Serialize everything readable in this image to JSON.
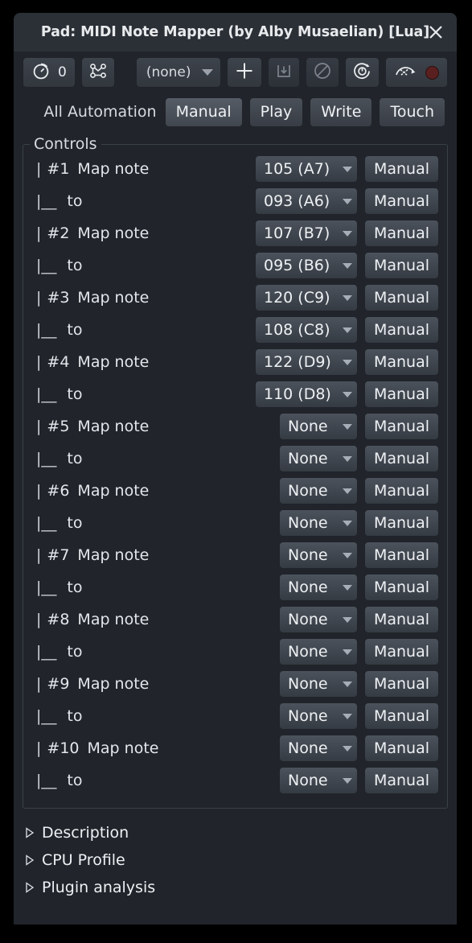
{
  "window": {
    "title": "Pad: MIDI Note Mapper (by Alby Musaelian) [Lua]",
    "close_icon": "close-icon"
  },
  "toolbar": {
    "delta_counter": "0",
    "delta_icon": "timer-icon",
    "automation_curve_icon": "automation-node-graph-icon",
    "preset_combo": "(none)",
    "add_icon": "plus-icon",
    "save_preset_icon": "save-to-disk-icon",
    "bypass_icon": "no-entry-icon",
    "reset_icon": "power-reset-icon",
    "pin_icon": "pin-automation-icon",
    "record_icon": "record-dot-icon"
  },
  "automation": {
    "label": "All Automation",
    "modes": [
      "Manual",
      "Play",
      "Write",
      "Touch"
    ],
    "selected": "Manual"
  },
  "controls": {
    "legend": "Controls",
    "manual_label": "Manual",
    "rows": [
      {
        "bar": "|",
        "index": "#1",
        "name": "Map note",
        "value": "105 (A7)",
        "width": "wide",
        "mode": "Manual"
      },
      {
        "bar": "|__",
        "index": "",
        "name": "to",
        "value": "093 (A6)",
        "width": "wide",
        "mode": "Manual"
      },
      {
        "bar": "|",
        "index": "#2",
        "name": "Map note",
        "value": "107 (B7)",
        "width": "wide",
        "mode": "Manual"
      },
      {
        "bar": "|__",
        "index": "",
        "name": "to",
        "value": "095 (B6)",
        "width": "wide",
        "mode": "Manual"
      },
      {
        "bar": "|",
        "index": "#3",
        "name": "Map note",
        "value": "120 (C9)",
        "width": "wide",
        "mode": "Manual"
      },
      {
        "bar": "|__",
        "index": "",
        "name": "to",
        "value": "108 (C8)",
        "width": "wide",
        "mode": "Manual"
      },
      {
        "bar": "|",
        "index": "#4",
        "name": "Map note",
        "value": "122 (D9)",
        "width": "wide",
        "mode": "Manual"
      },
      {
        "bar": "|__",
        "index": "",
        "name": "to",
        "value": "110 (D8)",
        "width": "wide",
        "mode": "Manual"
      },
      {
        "bar": "|",
        "index": "#5",
        "name": "Map note",
        "value": "None",
        "width": "narrow",
        "mode": "Manual"
      },
      {
        "bar": "|__",
        "index": "",
        "name": "to",
        "value": "None",
        "width": "narrow",
        "mode": "Manual"
      },
      {
        "bar": "|",
        "index": "#6",
        "name": "Map note",
        "value": "None",
        "width": "narrow",
        "mode": "Manual"
      },
      {
        "bar": "|__",
        "index": "",
        "name": "to",
        "value": "None",
        "width": "narrow",
        "mode": "Manual"
      },
      {
        "bar": "|",
        "index": "#7",
        "name": "Map note",
        "value": "None",
        "width": "narrow",
        "mode": "Manual"
      },
      {
        "bar": "|__",
        "index": "",
        "name": "to",
        "value": "None",
        "width": "narrow",
        "mode": "Manual"
      },
      {
        "bar": "|",
        "index": "#8",
        "name": "Map note",
        "value": "None",
        "width": "narrow",
        "mode": "Manual"
      },
      {
        "bar": "|__",
        "index": "",
        "name": "to",
        "value": "None",
        "width": "narrow",
        "mode": "Manual"
      },
      {
        "bar": "|",
        "index": "#9",
        "name": "Map note",
        "value": "None",
        "width": "narrow",
        "mode": "Manual"
      },
      {
        "bar": "|__",
        "index": "",
        "name": "to",
        "value": "None",
        "width": "narrow",
        "mode": "Manual"
      },
      {
        "bar": "|",
        "index": "#10",
        "name": "Map note",
        "value": "None",
        "width": "narrow",
        "mode": "Manual"
      },
      {
        "bar": "|__",
        "index": "",
        "name": "to",
        "value": "None",
        "width": "narrow",
        "mode": "Manual"
      }
    ]
  },
  "expanders": [
    {
      "label": "Description",
      "icon": "expander-triangle-icon"
    },
    {
      "label": "CPU Profile",
      "icon": "expander-triangle-icon"
    },
    {
      "label": "Plugin analysis",
      "icon": "expander-triangle-icon"
    }
  ],
  "colors": {
    "window_bg": "#21252b",
    "titlebar_bg": "#2b3037",
    "text": "#e8eaec",
    "button_top": "#4b525b",
    "button_bottom": "#353b43",
    "record_red": "#5a1f1f"
  }
}
